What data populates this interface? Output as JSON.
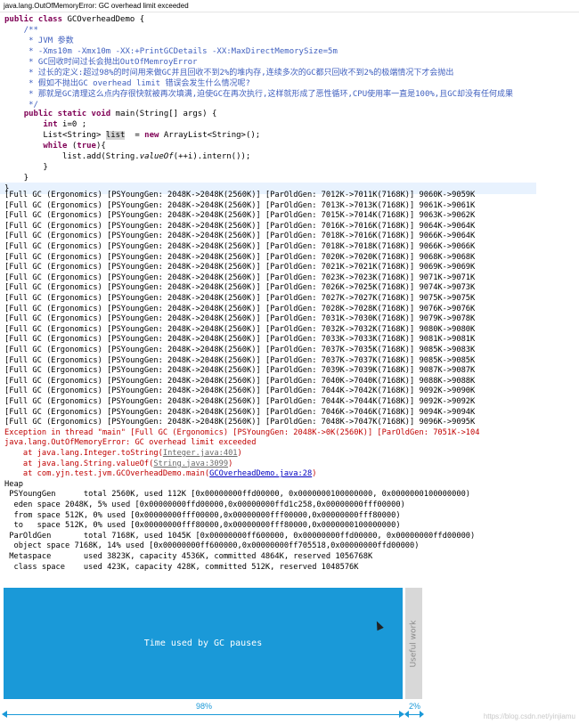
{
  "window": {
    "title": "java.lang.OutOfMemoryError: GC overhead limit exceeded"
  },
  "editor": {
    "class_decl": "public class GCOverheadDemo {",
    "comment_open": "    /**",
    "comment_lines": [
      "     * JVM 参数",
      "     * -Xms10m -Xmx10m -XX:+PrintGCDetails -XX:MaxDirectMemorySize=5m",
      "     * GC回收时间过长会抛出OutOfMemroyError",
      "     * 过长的定义:超过98%的时间用来做GC并且回收不到2%的堆内存,连续多次的GC都只回收不到2%的极端情况下才会抛出",
      "     * 假如不抛出GC overhead limit 错误会发生什么情况呢?",
      "     * 那就是GC清理这么点内存很快就被再次填满,迫使GC在再次执行,这样就形成了恶性循环,CPU使用率一直是100%,且GC却没有任何成果"
    ],
    "comment_close": "     */",
    "method_decl": "    public static void main(String[] args) {",
    "line_init": "        int i=0 ;",
    "line_list": "        List<String> list  = new ArrayList<String>();",
    "line_while": "        while (true){",
    "line_add": "            list.add(String.valueOf(++i).intern());",
    "line_close_while": "        }",
    "line_close_method": "    }",
    "line_close_class": "}"
  },
  "console": {
    "gc_lines": [
      "[Full GC (Ergonomics) [PSYoungGen: 2048K->2048K(2560K)] [ParOldGen: 7012K->7011K(7168K)] 9060K->9059K",
      "[Full GC (Ergonomics) [PSYoungGen: 2048K->2048K(2560K)] [ParOldGen: 7013K->7013K(7168K)] 9061K->9061K",
      "[Full GC (Ergonomics) [PSYoungGen: 2048K->2048K(2560K)] [ParOldGen: 7015K->7014K(7168K)] 9063K->9062K",
      "[Full GC (Ergonomics) [PSYoungGen: 2048K->2048K(2560K)] [ParOldGen: 7016K->7016K(7168K)] 9064K->9064K",
      "[Full GC (Ergonomics) [PSYoungGen: 2048K->2048K(2560K)] [ParOldGen: 7018K->7016K(7168K)] 9066K->9064K",
      "[Full GC (Ergonomics) [PSYoungGen: 2048K->2048K(2560K)] [ParOldGen: 7018K->7018K(7168K)] 9066K->9066K",
      "[Full GC (Ergonomics) [PSYoungGen: 2048K->2048K(2560K)] [ParOldGen: 7020K->7020K(7168K)] 9068K->9068K",
      "[Full GC (Ergonomics) [PSYoungGen: 2048K->2048K(2560K)] [ParOldGen: 7021K->7021K(7168K)] 9069K->9069K",
      "[Full GC (Ergonomics) [PSYoungGen: 2048K->2048K(2560K)] [ParOldGen: 7023K->7023K(7168K)] 9071K->9071K",
      "[Full GC (Ergonomics) [PSYoungGen: 2048K->2048K(2560K)] [ParOldGen: 7026K->7025K(7168K)] 9074K->9073K",
      "[Full GC (Ergonomics) [PSYoungGen: 2048K->2048K(2560K)] [ParOldGen: 7027K->7027K(7168K)] 9075K->9075K",
      "[Full GC (Ergonomics) [PSYoungGen: 2048K->2048K(2560K)] [ParOldGen: 7028K->7028K(7168K)] 9076K->9076K",
      "[Full GC (Ergonomics) [PSYoungGen: 2048K->2048K(2560K)] [ParOldGen: 7031K->7030K(7168K)] 9079K->9078K",
      "[Full GC (Ergonomics) [PSYoungGen: 2048K->2048K(2560K)] [ParOldGen: 7032K->7032K(7168K)] 9080K->9080K",
      "[Full GC (Ergonomics) [PSYoungGen: 2048K->2048K(2560K)] [ParOldGen: 7033K->7033K(7168K)] 9081K->9081K",
      "[Full GC (Ergonomics) [PSYoungGen: 2048K->2048K(2560K)] [ParOldGen: 7037K->7035K(7168K)] 9085K->9083K",
      "[Full GC (Ergonomics) [PSYoungGen: 2048K->2048K(2560K)] [ParOldGen: 7037K->7037K(7168K)] 9085K->9085K",
      "[Full GC (Ergonomics) [PSYoungGen: 2048K->2048K(2560K)] [ParOldGen: 7039K->7039K(7168K)] 9087K->9087K",
      "[Full GC (Ergonomics) [PSYoungGen: 2048K->2048K(2560K)] [ParOldGen: 7040K->7040K(7168K)] 9088K->9088K",
      "[Full GC (Ergonomics) [PSYoungGen: 2048K->2048K(2560K)] [ParOldGen: 7044K->7042K(7168K)] 9092K->9090K",
      "[Full GC (Ergonomics) [PSYoungGen: 2048K->2048K(2560K)] [ParOldGen: 7044K->7044K(7168K)] 9092K->9092K",
      "[Full GC (Ergonomics) [PSYoungGen: 2048K->2048K(2560K)] [ParOldGen: 7046K->7046K(7168K)] 9094K->9094K",
      "[Full GC (Ergonomics) [PSYoungGen: 2048K->2048K(2560K)] [ParOldGen: 7048K->7047K(7168K)] 9096K->9095K"
    ],
    "exception_line": "Exception in thread \"main\" [Full GC (Ergonomics) [PSYoungGen: 2048K->0K(2560K)] [ParOldGen: 7051K->104",
    "error_line": "java.lang.OutOfMemoryError: GC overhead limit exceeded",
    "stack": [
      {
        "prefix": "    at java.lang.Integer.toString(",
        "link": "Integer.java:401",
        "suffix": ")"
      },
      {
        "prefix": "    at java.lang.String.valueOf(",
        "link": "String.java:3099",
        "suffix": ")"
      },
      {
        "prefix": "    at com.yjn.test.jvm.GCOverheadDemo.main(",
        "link": "GCOverheadDemo.java:28",
        "suffix": ")"
      }
    ],
    "heap_lines": [
      "Heap",
      " PSYoungGen      total 2560K, used 112K [0x00000000ffd00000, 0x0000000100000000, 0x0000000100000000)",
      "  eden space 2048K, 5% used [0x00000000ffd00000,0x00000000ffd1c258,0x00000000fff00000)",
      "  from space 512K, 0% used [0x00000000fff00000,0x00000000fff00000,0x00000000fff80000)",
      "  to   space 512K, 0% used [0x00000000fff80000,0x00000000fff80000,0x0000000100000000)",
      " ParOldGen       total 7168K, used 1045K [0x00000000ff600000, 0x00000000ffd00000, 0x00000000ffd00000)",
      "  object space 7168K, 14% used [0x00000000ff600000,0x00000000ff705518,0x00000000ffd00000)",
      " Metaspace       used 3823K, capacity 4536K, committed 4864K, reserved 1056768K",
      "  class space    used 423K, capacity 428K, committed 512K, reserved 1048576K"
    ]
  },
  "colors": {
    "gc_bar": "#1a99d8",
    "work_bar": "#d8d8d8",
    "error": "#c00000",
    "link": "#0000c0"
  },
  "chart_data": {
    "type": "bar",
    "orientation": "horizontal-stacked",
    "categories": [
      "Time used by GC pauses",
      "Useful work"
    ],
    "values": [
      98,
      2
    ],
    "labels": [
      "98%",
      "2%"
    ],
    "title": ""
  },
  "watermark": "https://blog.csdn.net/yinjiamu"
}
